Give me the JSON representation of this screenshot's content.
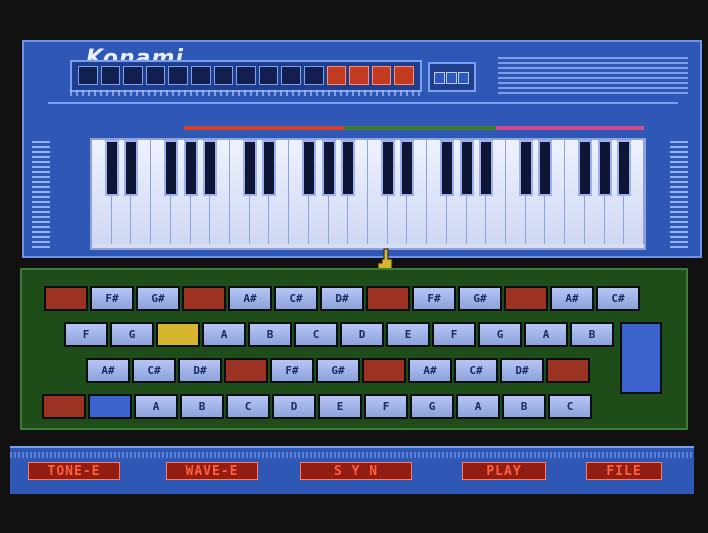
{
  "brand": {
    "logo": "Konami"
  },
  "display": {
    "cells": [
      0,
      0,
      0,
      0,
      0,
      0,
      0,
      0,
      0,
      0,
      0,
      1,
      1,
      1,
      1
    ]
  },
  "keyboard": {
    "octaves": 2
  },
  "menu": {
    "tone": "TONE-E",
    "wave": "WAVE-E",
    "syn": "S Y N",
    "play": "PLAY",
    "file": "FILE"
  },
  "colors": {
    "accent": "#2f58b6",
    "green": "#1f4d1a",
    "red": "#9c3222",
    "menu_text": "#ff5f3d"
  },
  "keys": [
    {
      "label": "",
      "color": "red"
    },
    {
      "label": "F#",
      "color": "blue"
    },
    {
      "label": "G#",
      "color": "blue"
    },
    {
      "label": "",
      "color": "red"
    },
    {
      "label": "A#",
      "color": "blue"
    },
    {
      "label": "C#",
      "color": "blue"
    },
    {
      "label": "D#",
      "color": "blue"
    },
    {
      "label": "",
      "color": "red"
    },
    {
      "label": "F#",
      "color": "blue"
    },
    {
      "label": "G#",
      "color": "blue"
    },
    {
      "label": "",
      "color": "red"
    },
    {
      "label": "A#",
      "color": "blue"
    },
    {
      "label": "C#",
      "color": "blue"
    },
    {
      "label": "F",
      "color": "blue"
    },
    {
      "label": "G",
      "color": "blue"
    },
    {
      "label": "",
      "color": "yellow"
    },
    {
      "label": "A",
      "color": "blue"
    },
    {
      "label": "B",
      "color": "blue"
    },
    {
      "label": "C",
      "color": "blue"
    },
    {
      "label": "D",
      "color": "blue"
    },
    {
      "label": "E",
      "color": "blue"
    },
    {
      "label": "F",
      "color": "blue"
    },
    {
      "label": "G",
      "color": "blue"
    },
    {
      "label": "A",
      "color": "blue"
    },
    {
      "label": "B",
      "color": "blue"
    },
    {
      "label": "A#",
      "color": "blue"
    },
    {
      "label": "C#",
      "color": "blue"
    },
    {
      "label": "D#",
      "color": "blue"
    },
    {
      "label": "",
      "color": "red"
    },
    {
      "label": "F#",
      "color": "blue"
    },
    {
      "label": "G#",
      "color": "blue"
    },
    {
      "label": "",
      "color": "red"
    },
    {
      "label": "A#",
      "color": "blue"
    },
    {
      "label": "C#",
      "color": "blue"
    },
    {
      "label": "D#",
      "color": "blue"
    },
    {
      "label": "",
      "color": "red"
    },
    {
      "label": "",
      "color": "red"
    },
    {
      "label": "",
      "color": "wide"
    },
    {
      "label": "A",
      "color": "blue"
    },
    {
      "label": "B",
      "color": "blue"
    },
    {
      "label": "C",
      "color": "blue"
    },
    {
      "label": "D",
      "color": "blue"
    },
    {
      "label": "E",
      "color": "blue"
    },
    {
      "label": "F",
      "color": "blue"
    },
    {
      "label": "G",
      "color": "blue"
    },
    {
      "label": "A",
      "color": "blue"
    },
    {
      "label": "B",
      "color": "blue"
    },
    {
      "label": "C",
      "color": "blue"
    },
    {
      "label": "",
      "color": "wide"
    },
    {
      "label": "",
      "color": "wide"
    }
  ]
}
